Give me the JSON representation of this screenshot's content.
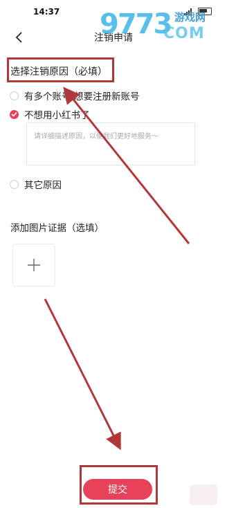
{
  "status_bar": {
    "time": "14:37"
  },
  "nav": {
    "title": "注销申请"
  },
  "watermark": {
    "number": "9773",
    "site": "游戏网",
    "com": "COM"
  },
  "form": {
    "section_title": "选择注销原因（必填）",
    "options": [
      {
        "label": "有多个账号/想要注册新账号",
        "checked": false
      },
      {
        "label": "不想用小红书了",
        "checked": true
      },
      {
        "label": "其它原因",
        "checked": false
      }
    ],
    "reason_placeholder": "请详细描述原因，以便我们更好地服务～",
    "upload_title": "添加图片证据（选填）",
    "submit_label": "提交"
  },
  "colors": {
    "accent": "#e8415a",
    "annotation": "#b0383a"
  }
}
